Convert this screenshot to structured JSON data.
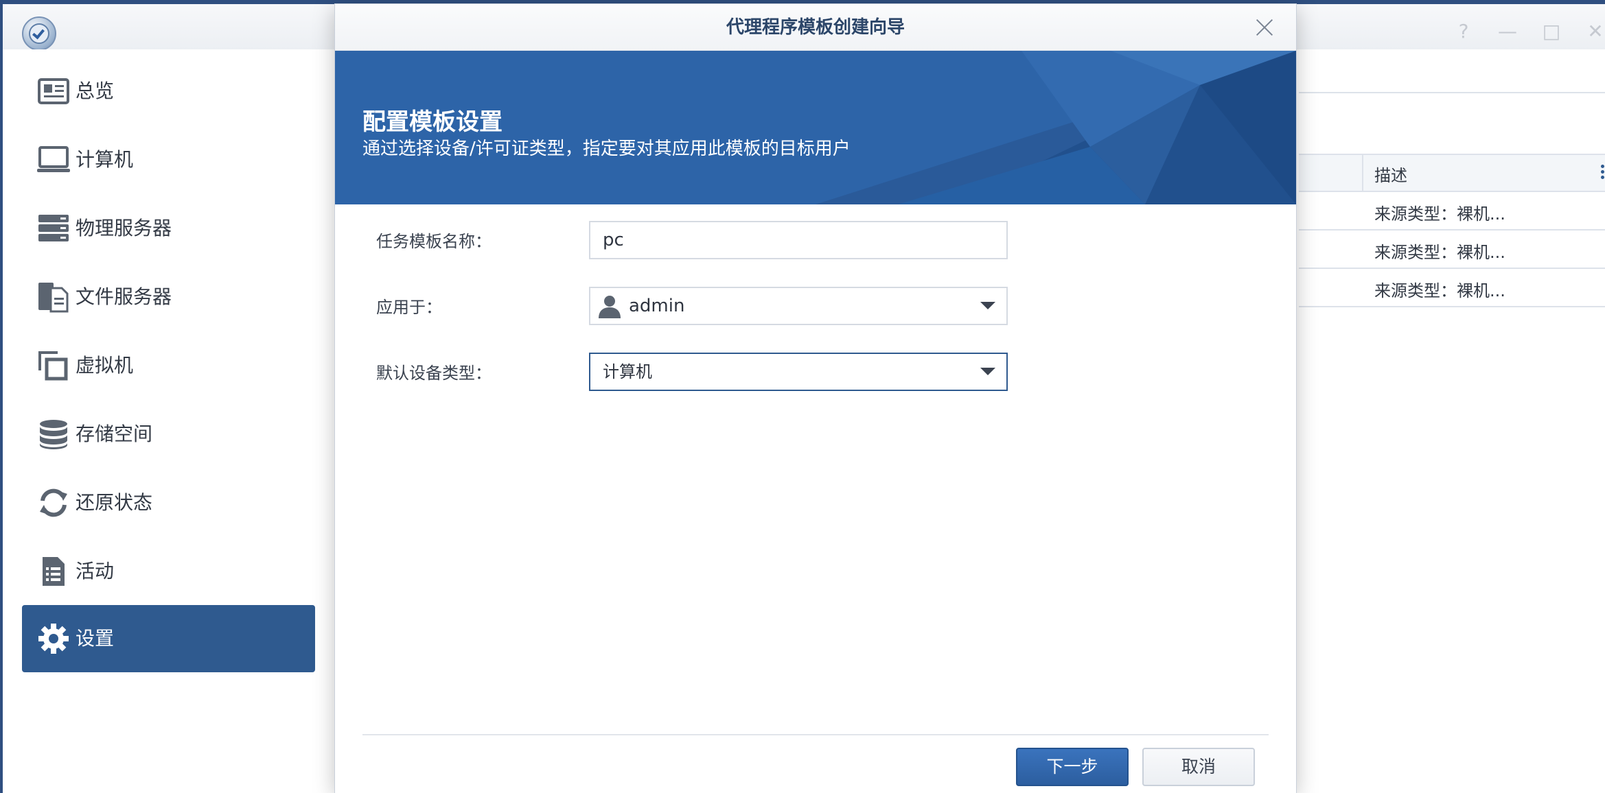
{
  "app": {
    "sidebar": {
      "items": [
        {
          "label": "总览",
          "icon": "overview-icon"
        },
        {
          "label": "计算机",
          "icon": "computer-icon"
        },
        {
          "label": "物理服务器",
          "icon": "server-icon"
        },
        {
          "label": "文件服务器",
          "icon": "file-server-icon"
        },
        {
          "label": "虚拟机",
          "icon": "virtual-machine-icon"
        },
        {
          "label": "存储空间",
          "icon": "storage-icon"
        },
        {
          "label": "还原状态",
          "icon": "restore-icon"
        },
        {
          "label": "活动",
          "icon": "activity-icon"
        },
        {
          "label": "设置",
          "icon": "gear-icon",
          "active": true
        }
      ]
    },
    "window_controls": [
      "?",
      "—",
      "□",
      "✕"
    ],
    "table": {
      "header_desc": "描述",
      "rows": [
        {
          "desc": "来源类型：裸机..."
        },
        {
          "desc": "来源类型：裸机..."
        },
        {
          "desc": "来源类型：裸机..."
        }
      ]
    }
  },
  "dialog": {
    "title": "代理程序模板创建向导",
    "banner": {
      "title": "配置模板设置",
      "subtitle": "通过选择设备/许可证类型，指定要对其应用此模板的目标用户"
    },
    "form": {
      "template_name_label": "任务模板名称：",
      "template_name_value": "pc",
      "apply_to_label": "应用于：",
      "apply_to_value": "admin",
      "device_type_label": "默认设备类型：",
      "device_type_value": "计算机"
    },
    "buttons": {
      "next": "下一步",
      "cancel": "取消"
    }
  },
  "colors": {
    "accent": "#2f5a8f",
    "banner": "#2d64a8",
    "primary_button": "#2c5e9f"
  }
}
